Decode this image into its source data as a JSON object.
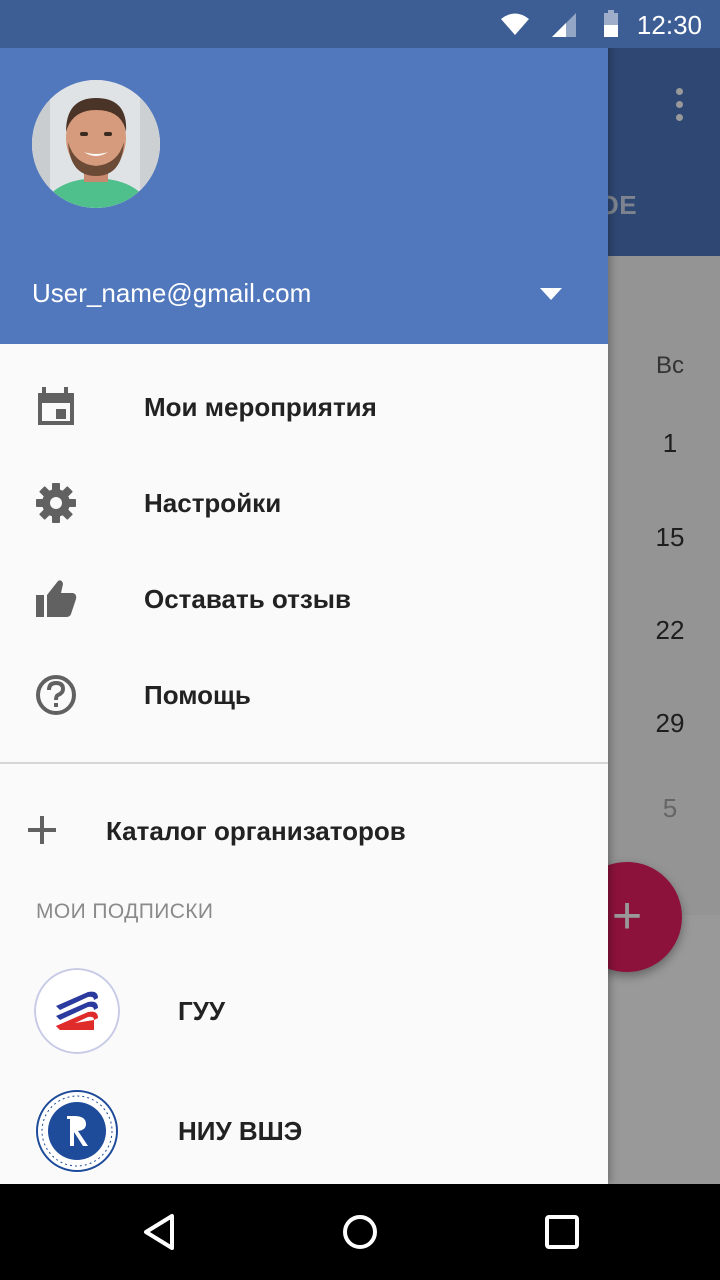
{
  "status_bar": {
    "time": "12:30"
  },
  "background": {
    "tab_partial": "ННОЕ",
    "weekday_header": "Вс",
    "dates": [
      "1",
      "15",
      "22",
      "29",
      "5"
    ],
    "fab_icon": "plus-icon"
  },
  "drawer": {
    "account": {
      "email": "User_name@gmail.com"
    },
    "menu": [
      {
        "label": "Мои мероприятия",
        "icon": "calendar-icon"
      },
      {
        "label": "Настройки",
        "icon": "settings-gear-icon"
      },
      {
        "label": "Оставать отзыв",
        "icon": "thumb-up-icon"
      },
      {
        "label": "Помощь",
        "icon": "help-icon"
      }
    ],
    "catalog": {
      "label": "Каталог организаторов",
      "icon": "plus-icon"
    },
    "subscriptions": {
      "title": "МОИ ПОДПИСКИ",
      "items": [
        {
          "label": "ГУУ",
          "icon": "guu-logo"
        },
        {
          "label": "НИУ ВШЭ",
          "icon": "hse-logo"
        }
      ]
    }
  },
  "colors": {
    "primary": "#5178bd",
    "status_bar": "#3d5d95",
    "accent": "#e91e63"
  }
}
